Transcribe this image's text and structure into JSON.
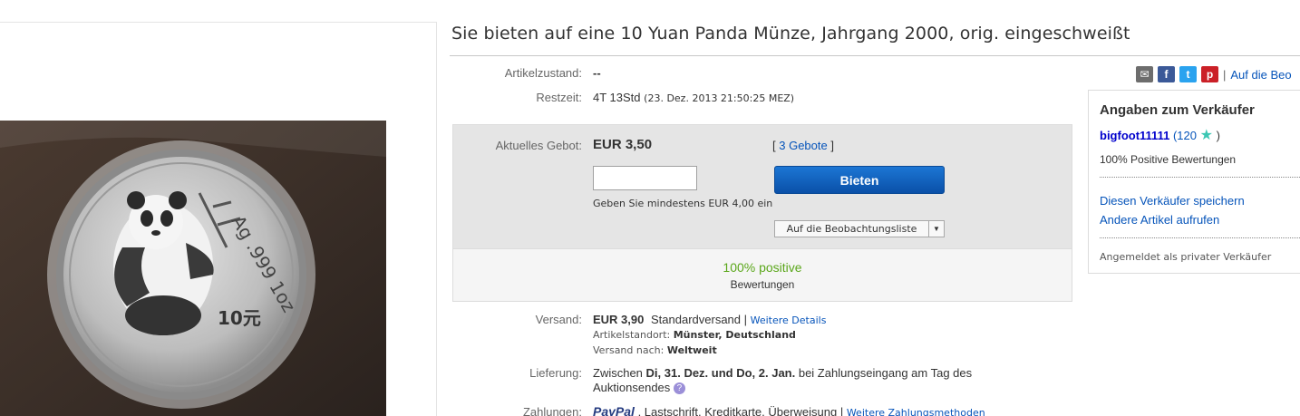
{
  "title": "Sie bieten auf eine 10 Yuan Panda Münze, Jahrgang 2000, orig. eingeschweißt",
  "image": {
    "coin_text_top": "Ag .999 1oz",
    "coin_text_value": "10元"
  },
  "condition": {
    "label": "Artikelzustand:",
    "value": "--"
  },
  "time_left": {
    "label": "Restzeit:",
    "value": "4T 13Std",
    "end": "(23. Dez. 2013  21:50:25 MEZ)"
  },
  "share": {
    "icons": [
      "email-icon",
      "facebook-icon",
      "twitter-icon",
      "pinterest-icon"
    ],
    "separator": "|",
    "watch_link": "Auf die Beo"
  },
  "bid": {
    "current_label": "Aktuelles Gebot:",
    "current_value": "EUR 3,50",
    "bids_open": "[",
    "bids_count": "3 Gebote",
    "bids_close": "]",
    "input_value": "",
    "button": "Bieten",
    "hint": "Geben Sie mindestens EUR 4,00 ein",
    "watch_button": "Auf die Beobachtungsliste",
    "watch_dropdown": "▼"
  },
  "feedback": {
    "percent": "100% positive",
    "label": "Bewertungen"
  },
  "shipping": {
    "label": "Versand:",
    "price": "EUR 3,90",
    "method": "Standardversand |",
    "details_link": "Weitere Details",
    "location_label": "Artikelstandort:",
    "location": "Münster, Deutschland",
    "to_label": "Versand nach:",
    "to": "Weltweit"
  },
  "delivery": {
    "label": "Lieferung:",
    "text_before": "Zwischen ",
    "dates": "Di, 31. Dez. und Do, 2. Jan.",
    "text_after": " bei Zahlungseingang am Tag des",
    "line2": "Auktionsendes",
    "help_icon": "?"
  },
  "payment": {
    "label": "Zahlungen:",
    "paypal": "PayPal",
    "methods": ",  Lastschrift,  Kreditkarte,  Überweisung  |",
    "more_link": "Weitere Zahlungsmethoden"
  },
  "seller": {
    "heading": "Angaben zum Verkäufer",
    "name": "bigfoot11111",
    "score_open": "(120",
    "score_close": ")",
    "positive": "100% Positive Bewertungen",
    "save_link": "Diesen Verkäufer speichern",
    "other_link": "Andere Artikel aufrufen",
    "type": "Angemeldet als privater Verkäufer"
  },
  "colors": {
    "link": "#0654ba",
    "button": "#0a50a8",
    "positive": "#5ba71b",
    "seller_name": "#0000cc",
    "star": "#3cc7b3"
  }
}
